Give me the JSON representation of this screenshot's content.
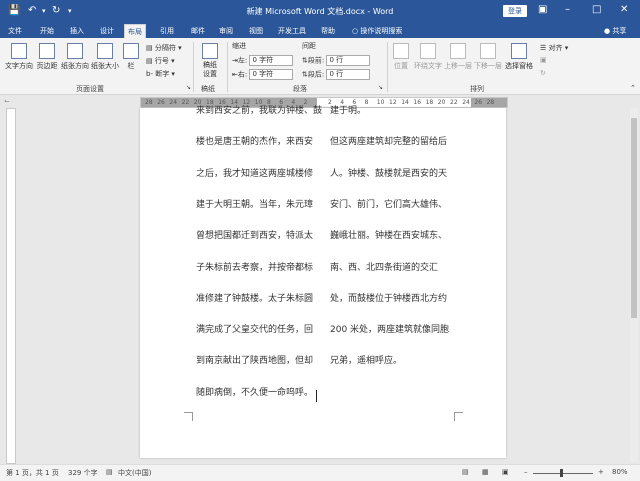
{
  "title_bar": {
    "title": "新建 Microsoft Word 文档.docx  -  Word",
    "login": "登录"
  },
  "tabs": [
    "文件",
    "开始",
    "插入",
    "设计",
    "布局",
    "引用",
    "邮件",
    "审阅",
    "视图",
    "开发工具",
    "帮助"
  ],
  "active_tab": "布局",
  "tell_me": "操作说明搜索",
  "share": "共享",
  "ribbon": {
    "page_setup": {
      "text_direction": "文字方向",
      "margins": "页边距",
      "orientation": "纸张方向",
      "size": "纸张大小",
      "columns": "栏",
      "breaks": "分隔符",
      "line_numbers": "行号",
      "hyphenation": "断字",
      "label": "页面设置"
    },
    "draft": {
      "button": "稿纸设置",
      "label": "稿纸"
    },
    "paragraph": {
      "indent_header": "缩进",
      "spacing_header": "间距",
      "left_label": "左:",
      "right_label": "右:",
      "left_value": "0 字符",
      "right_value": "0 字符",
      "before_label": "段前:",
      "after_label": "段后:",
      "before_value": "0 行",
      "after_value": "0 行",
      "label": "段落"
    },
    "arrange": {
      "position": "位置",
      "wrap_text": "环绕文字",
      "bring_forward": "上移一层",
      "send_backward": "下移一层",
      "selection_pane": "选择窗格",
      "align": "对齐",
      "label": "排列"
    }
  },
  "ruler": {
    "labels": [
      "28",
      "26",
      "24",
      "22",
      "20",
      "18",
      "16",
      "14",
      "12",
      "10",
      "8",
      "6",
      "4",
      "2",
      "",
      "2",
      "4",
      "6",
      "8",
      "10",
      "12",
      "14",
      "16",
      "18",
      "20",
      "22",
      "24",
      "26",
      "28"
    ]
  },
  "document": {
    "left_column": [
      "来到西安之前，我联为钟楼、鼓",
      "楼也是唐王朝的杰作，来西安",
      "之后，我才知道这两座城楼修",
      "建于大明王朝。当年，朱元璋",
      "曾想把国都迁到西安，特派太",
      "子朱标前去考察，并按帝都标",
      "准修建了钟鼓楼。太子朱标圆",
      "满完成了父皇交代的任务，回",
      "到南京献出了陕西地图，但却",
      "随即病倒，不久便一命呜呼。"
    ],
    "right_column": [
      "建于明。",
      "但这两座建筑却完整的留给后",
      "人。钟楼、鼓楼就是西安的天",
      "安门、前门，它们高大雄伟、",
      "巍峨壮丽。钟楼在西安城东、",
      "南、西、北四条街道的交汇",
      "处，而鼓楼位于钟楼西北方约",
      "200 米处，两座建筑就像同胞",
      "兄弟，遥相呼应。"
    ]
  },
  "status_bar": {
    "page": "第 1 页，共 1 页",
    "words": "329 个字",
    "language": "中文(中国)",
    "zoom": "80%"
  }
}
